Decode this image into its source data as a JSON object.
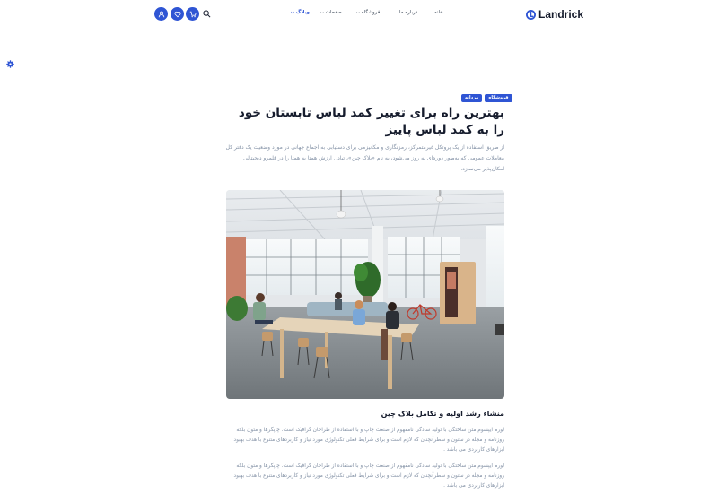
{
  "header": {
    "logo_text": "Landrick",
    "nav": {
      "home": "خانه",
      "about": "درباره ما",
      "shop": "فروشگاه",
      "pages": "صفحات",
      "blog": "وبلاگ"
    }
  },
  "icons": {
    "user": "user-icon",
    "heart": "heart-icon",
    "cart": "cart-icon",
    "search": "search-icon",
    "settings": "gear-icon"
  },
  "colors": {
    "primary": "#2f55d4",
    "heading": "#161c2d",
    "muted": "#8492a6"
  },
  "article": {
    "tags": [
      "فروشگاه",
      "مردانه"
    ],
    "title": "بهترین راه برای تغییر کمد لباس تابستان خود را به کمد لباس پاییز",
    "lead": "از طریق استفاده از یک پروتکل غیرمتمرکز، رمزنگاری و مکانیزمی برای دستیابی به اجماع جهانی در مورد وضعیت یک دفتر کل معاملات عمومی که به‌طور دوره‌ای به روز می‌شود، به نام «بلاک چین»، تبادل ارزش همتا به همتا را در قلمرو دیجیتالی امکان‌پذیر می‌سازد.",
    "section_title": "منشاء رشد اولیه و تکامل بلاک چین",
    "paragraphs": [
      "لورم ایپسوم متن ساختگی با تولید سادگی نامفهوم از صنعت چاپ و با استفاده از طراحان گرافیک است. چاپگرها و متون بلکه روزنامه و مجله در ستون و سطرآنچنان که لازم است و برای شرایط فعلی تکنولوژی مورد نیاز و کاربردهای متنوع با هدف بهبود ابزارهای کاربردی می باشد .",
      "لورم ایپسوم متن ساختگی با تولید سادگی نامفهوم از صنعت چاپ و با استفاده از طراحان گرافیک است. چاپگرها و متون بلکه روزنامه و مجله در ستون و سطرآنچنان که لازم است و برای شرایط فعلی تکنولوژی مورد نیاز و کاربردهای متنوع با هدف بهبود ابزارهای کاربردی می باشد ."
    ]
  }
}
